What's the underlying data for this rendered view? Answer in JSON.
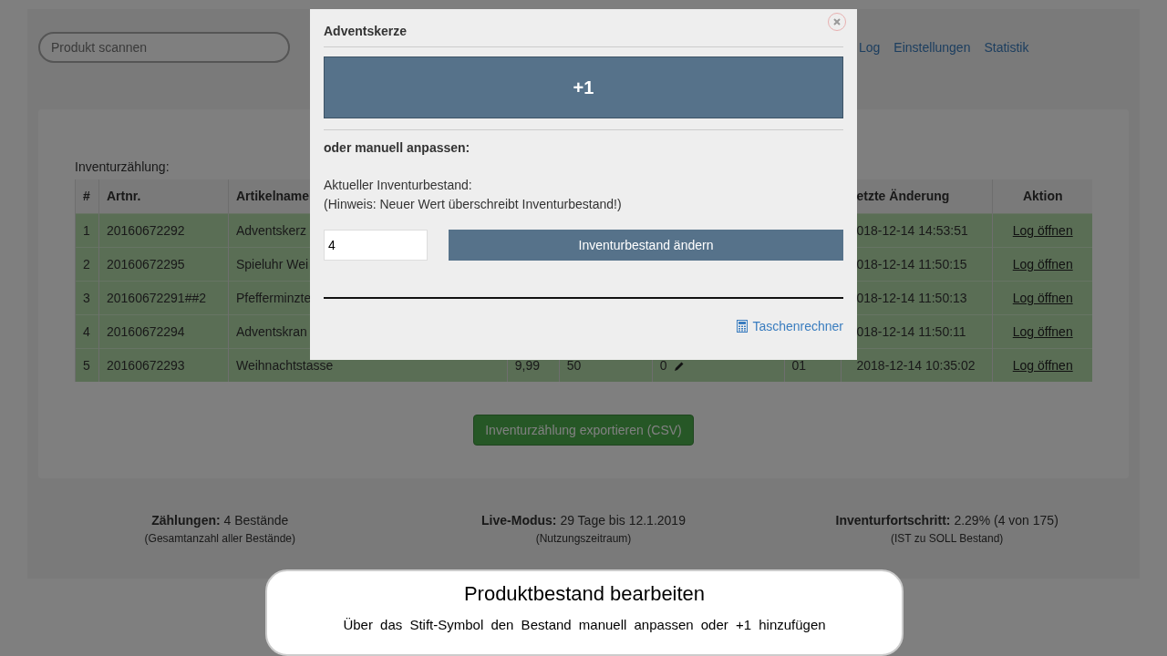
{
  "search": {
    "placeholder": "Produkt scannen"
  },
  "nav": [
    "Log",
    "Einstellungen",
    "Statistik"
  ],
  "table": {
    "caption": "Inventurzählung:",
    "columns": {
      "number": "#",
      "artnr": "Artnr.",
      "name": "Artikelname",
      "changed": "etzte Änderung",
      "action": "Aktion"
    },
    "rows": [
      {
        "number": "1",
        "artnr": "20160672292",
        "name": "Adventskerz",
        "changed": "018-12-14 14:53:51",
        "action": "Log öffnen"
      },
      {
        "number": "2",
        "artnr": "20160672295",
        "name": "Spieluhr Wei",
        "changed": "018-12-14 11:50:15",
        "action": "Log öffnen"
      },
      {
        "number": "3",
        "artnr": "20160672291##2",
        "name": "Pfefferminzte",
        "changed": "018-12-14 11:50:13",
        "action": "Log öffnen"
      },
      {
        "number": "4",
        "artnr": "20160672294",
        "name": "Adventskran",
        "changed": "018-12-14 11:50:11",
        "action": "Log öffnen"
      },
      {
        "number": "5",
        "artnr": "20160672293",
        "name": "Weihnachtstasse",
        "column_4": "9,99",
        "column_5": "50",
        "column_6": "0",
        "column_7": "01",
        "changed": "2018-12-14 10:35:02",
        "action": "Log öffnen"
      }
    ]
  },
  "export_button": "Inventurzählung exportieren (CSV)",
  "stats": [
    {
      "label": "Zählungen:",
      "value": "4 Bestände",
      "note": "(Gesamtanzahl aller Bestände)"
    },
    {
      "label": "Live-Modus:",
      "value": "29 Tage bis 12.1.2019",
      "note": "(Nutzungszeitraum)"
    },
    {
      "label": "Inventurfortschritt:",
      "value": "2.29% (4 von 175)",
      "note": "(IST zu SOLL Bestand)"
    }
  ],
  "modal": {
    "title": "Adventskerze",
    "increment_button": "+1",
    "manual_heading": "oder manuell anpassen:",
    "info_lines": [
      "Aktueller Inventurbestand:",
      "(Hinweis: Neuer Wert überschreibt Inventurbestand!)"
    ],
    "stock_input": {
      "value": "4"
    },
    "apply_button": "Inventurbestand ändern",
    "calculator_link": "Taschenrechner"
  },
  "caption": {
    "title": "Produktbestand bearbeiten",
    "text": "Über das Stift-Symbol den Bestand manuell anpassen oder +1 hinzufügen"
  }
}
